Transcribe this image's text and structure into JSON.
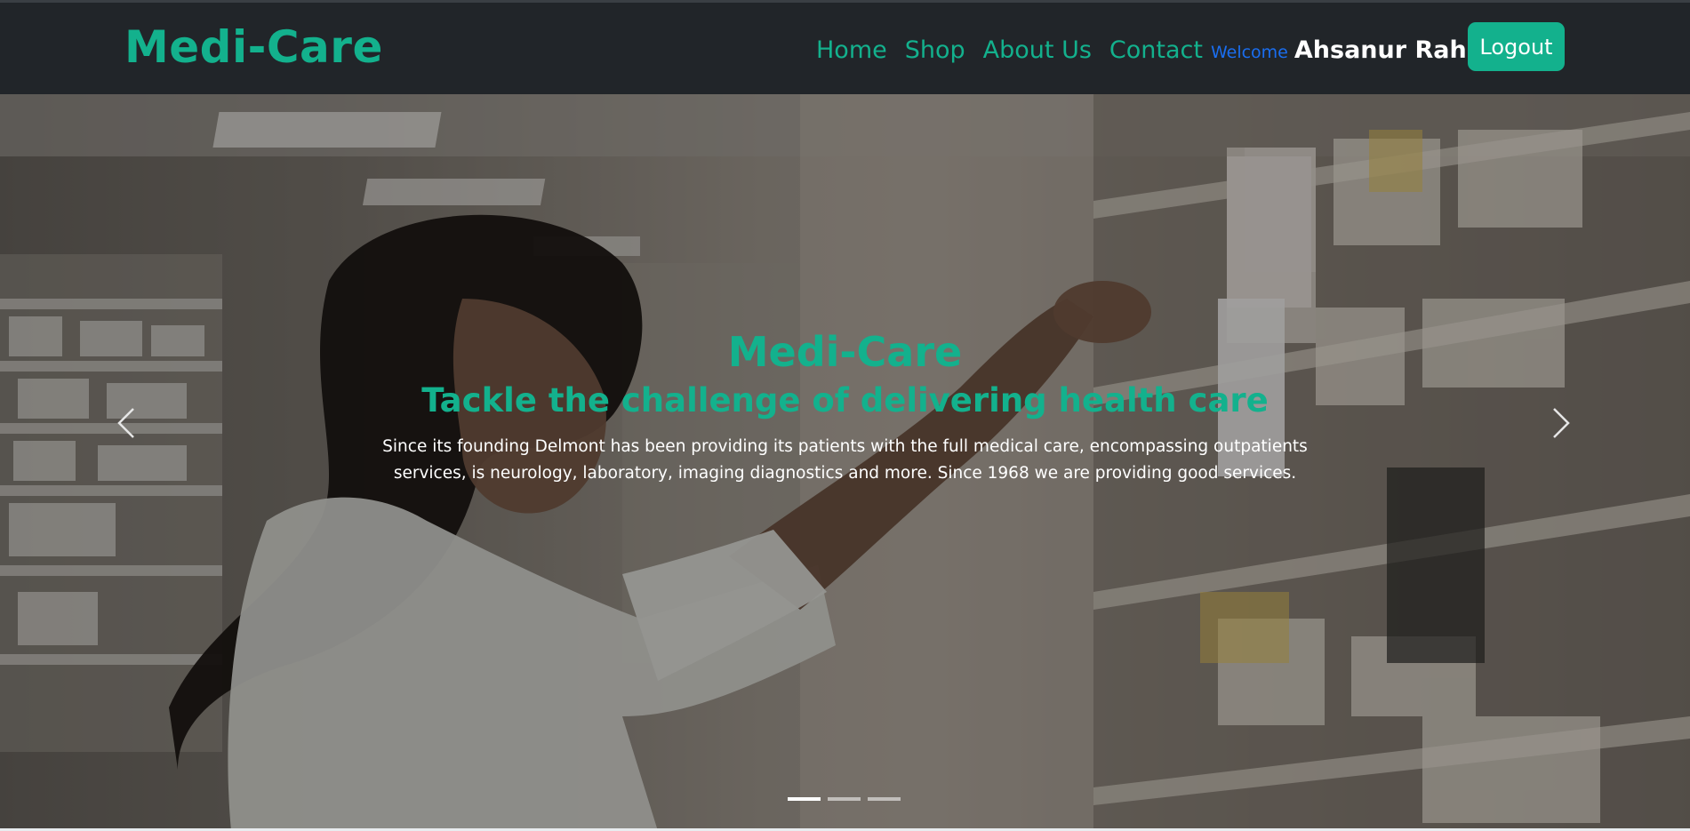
{
  "navbar": {
    "brand": "Medi-Care",
    "links": [
      {
        "label": "Home"
      },
      {
        "label": "Shop"
      },
      {
        "label": "About Us"
      },
      {
        "label": "Contact"
      }
    ],
    "welcome_label": "Welcome",
    "user_name": "Ahsanur Rahman",
    "logout_label": "Logout"
  },
  "hero": {
    "title": "Medi-Care",
    "subtitle": "Tackle the challenge of delivering health care",
    "text": "Since its founding Delmont has been providing its patients with the full medical care, encompassing outpatients services, is neurology, laboratory, imaging diagnostics and more. Since 1968 we are providing good services.",
    "slide_count": 3,
    "active_slide": 1,
    "prev_icon": "chevron-left-icon",
    "next_icon": "chevron-right-icon"
  },
  "colors": {
    "navbar_bg": "#212529",
    "accent": "#13b18d",
    "welcome": "#1a6ef0",
    "user_name": "#ffffff"
  }
}
